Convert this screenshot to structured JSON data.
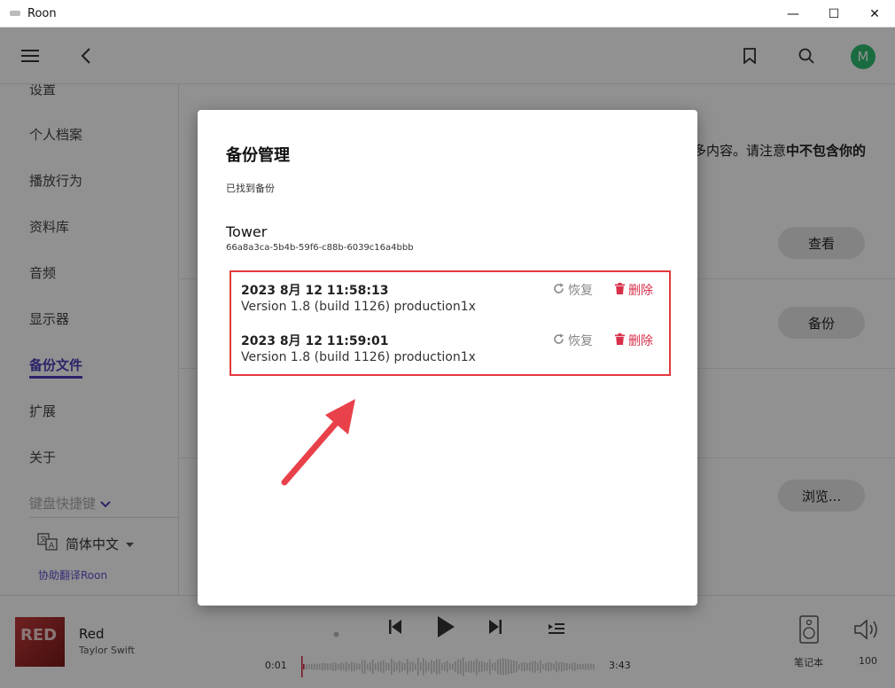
{
  "window": {
    "title": "Roon",
    "minimize": "—",
    "maximize": "☐",
    "close": "✕"
  },
  "topbar": {
    "avatar_letter": "M"
  },
  "sidebar": {
    "items": [
      "设置",
      "个人档案",
      "播放行为",
      "资料库",
      "音频",
      "显示器",
      "备份文件",
      "扩展",
      "关于",
      "键盘快捷键"
    ],
    "language": "简体中文",
    "help_link": "协助翻译Roon"
  },
  "content": {
    "partial_text_prefix": "多内容。请注意",
    "partial_text_bold": "中不包含你的",
    "view_button": "查看",
    "backup_button": "备份",
    "browse_button": "浏览..."
  },
  "player": {
    "track_title": "Red",
    "track_artist": "Taylor Swift",
    "album_art_text": "RED",
    "elapsed": "0:01",
    "duration": "3:43",
    "zone_label": "笔记本",
    "volume": "100"
  },
  "modal": {
    "title": "备份管理",
    "subtitle": "已找到备份",
    "device_name": "Tower",
    "device_id": "66a8a3ca-5b4b-59f6-c88b-6039c16a4bbb",
    "backups": [
      {
        "date": "2023 8月 12 11:58:13",
        "version": "Version 1.8 (build 1126) production1x",
        "restore": "恢复",
        "delete": "删除"
      },
      {
        "date": "2023 8月 12 11:59:01",
        "version": "Version 1.8 (build 1126) production1x",
        "restore": "恢复",
        "delete": "删除"
      }
    ]
  },
  "colors": {
    "accent": "#4a3fb8",
    "delete": "#d8304a",
    "highlight_box": "#e2393c",
    "avatar": "#2fbf71"
  }
}
